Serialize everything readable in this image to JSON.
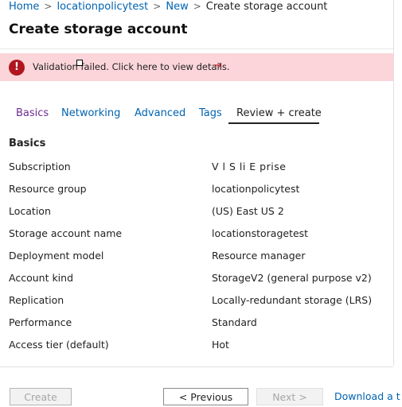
{
  "breadcrumb": {
    "items": [
      "Home",
      "locationpolicytest",
      "New",
      "Create storage account"
    ],
    "separator": ">"
  },
  "page_title": "Create storage account",
  "banner": {
    "message": "Validation failed. Click here to view details.",
    "arrow": "→",
    "icon": "error-icon",
    "icon_glyph": "!",
    "background": "#fbd5d9",
    "icon_color": "#b0161f"
  },
  "tabs": [
    {
      "label": "Basics"
    },
    {
      "label": "Networking"
    },
    {
      "label": "Advanced"
    },
    {
      "label": "Tags"
    },
    {
      "label": "Review + create",
      "selected": true
    }
  ],
  "section": {
    "title": "Basics",
    "rows": [
      {
        "label": "Subscription",
        "value": "V   l S  li  E    prise"
      },
      {
        "label": "Resource group",
        "value": "locationpolicytest"
      },
      {
        "label": "Location",
        "value": "(US) East US 2"
      },
      {
        "label": "Storage account name",
        "value": "locationstoragetest"
      },
      {
        "label": "Deployment model",
        "value": "Resource manager"
      },
      {
        "label": "Account kind",
        "value": "StorageV2 (general purpose v2)"
      },
      {
        "label": "Replication",
        "value": "Locally-redundant storage (LRS)"
      },
      {
        "label": "Performance",
        "value": "Standard"
      },
      {
        "label": "Access tier (default)",
        "value": "Hot"
      }
    ]
  },
  "footer": {
    "create_label": "Create",
    "previous_label": "< Previous",
    "next_label": "Next >",
    "download_label": "Download a t"
  },
  "colors": {
    "link": "#0063b1",
    "visited_tab": "#6b2c91"
  }
}
